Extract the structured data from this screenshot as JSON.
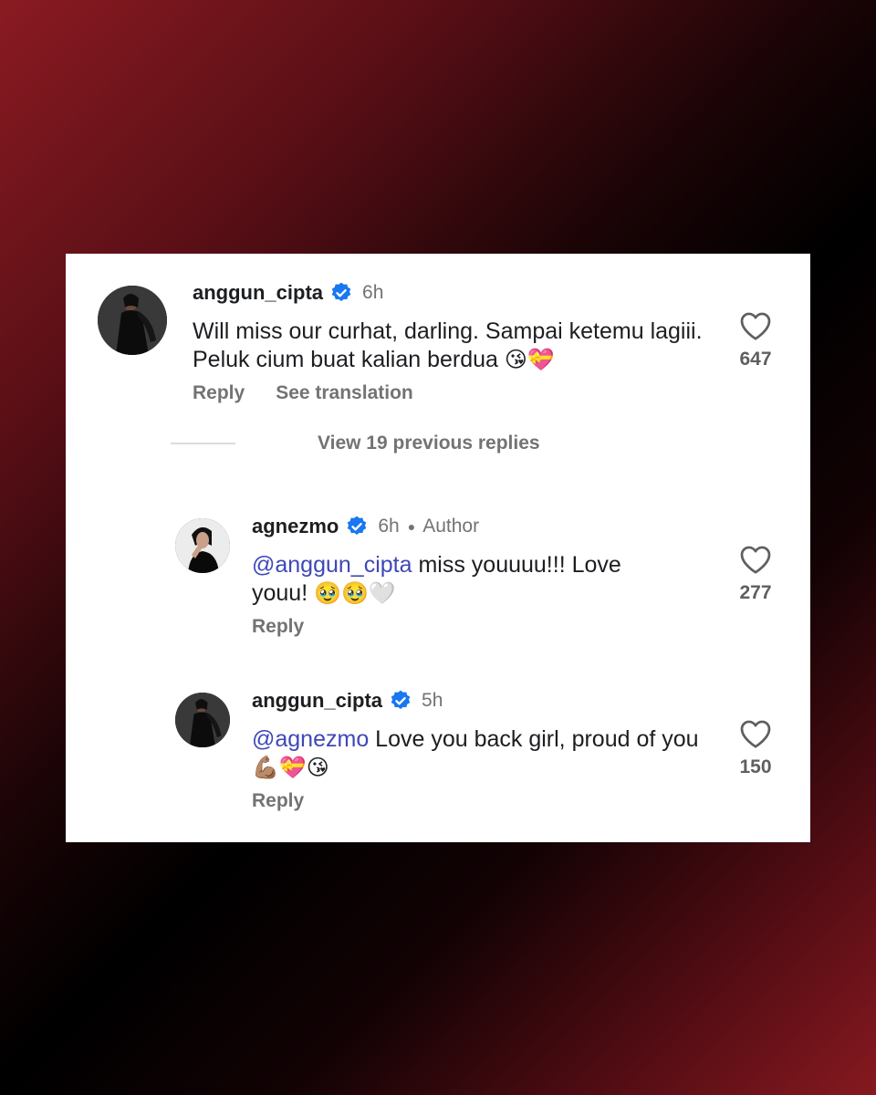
{
  "comments": [
    {
      "username": "anggun_cipta",
      "time": "6h",
      "text": "Will miss our curhat, darling. Sampai ketemu lagiii. Peluk cium buat kalian berdua",
      "emojis": "😘💝",
      "likes": "647",
      "reply_label": "Reply",
      "translate_label": "See translation",
      "avatar_icon": "avatar-anggun"
    },
    {
      "username": "agnezmo",
      "time": "6h",
      "badge": "Author",
      "mention": "@anggun_cipta",
      "text": " miss youuuu!!! Love youu!",
      "emojis": "🥹🥹🤍",
      "likes": "277",
      "reply_label": "Reply",
      "avatar_icon": "avatar-agnezmo"
    },
    {
      "username": "anggun_cipta",
      "time": "5h",
      "mention": "@agnezmo",
      "text": " Love you back girl, proud of you",
      "emojis": "💪🏽💝😘",
      "likes": "150",
      "reply_label": "Reply",
      "avatar_icon": "avatar-anggun"
    }
  ],
  "view_replies_label": "View 19 previous replies",
  "colors": {
    "verified": "#1877f2",
    "mention": "#3f47b8",
    "muted": "#737373",
    "text": "#1c1e21"
  },
  "icons": {
    "verified": "verified-badge-icon",
    "like": "heart-outline-icon"
  }
}
